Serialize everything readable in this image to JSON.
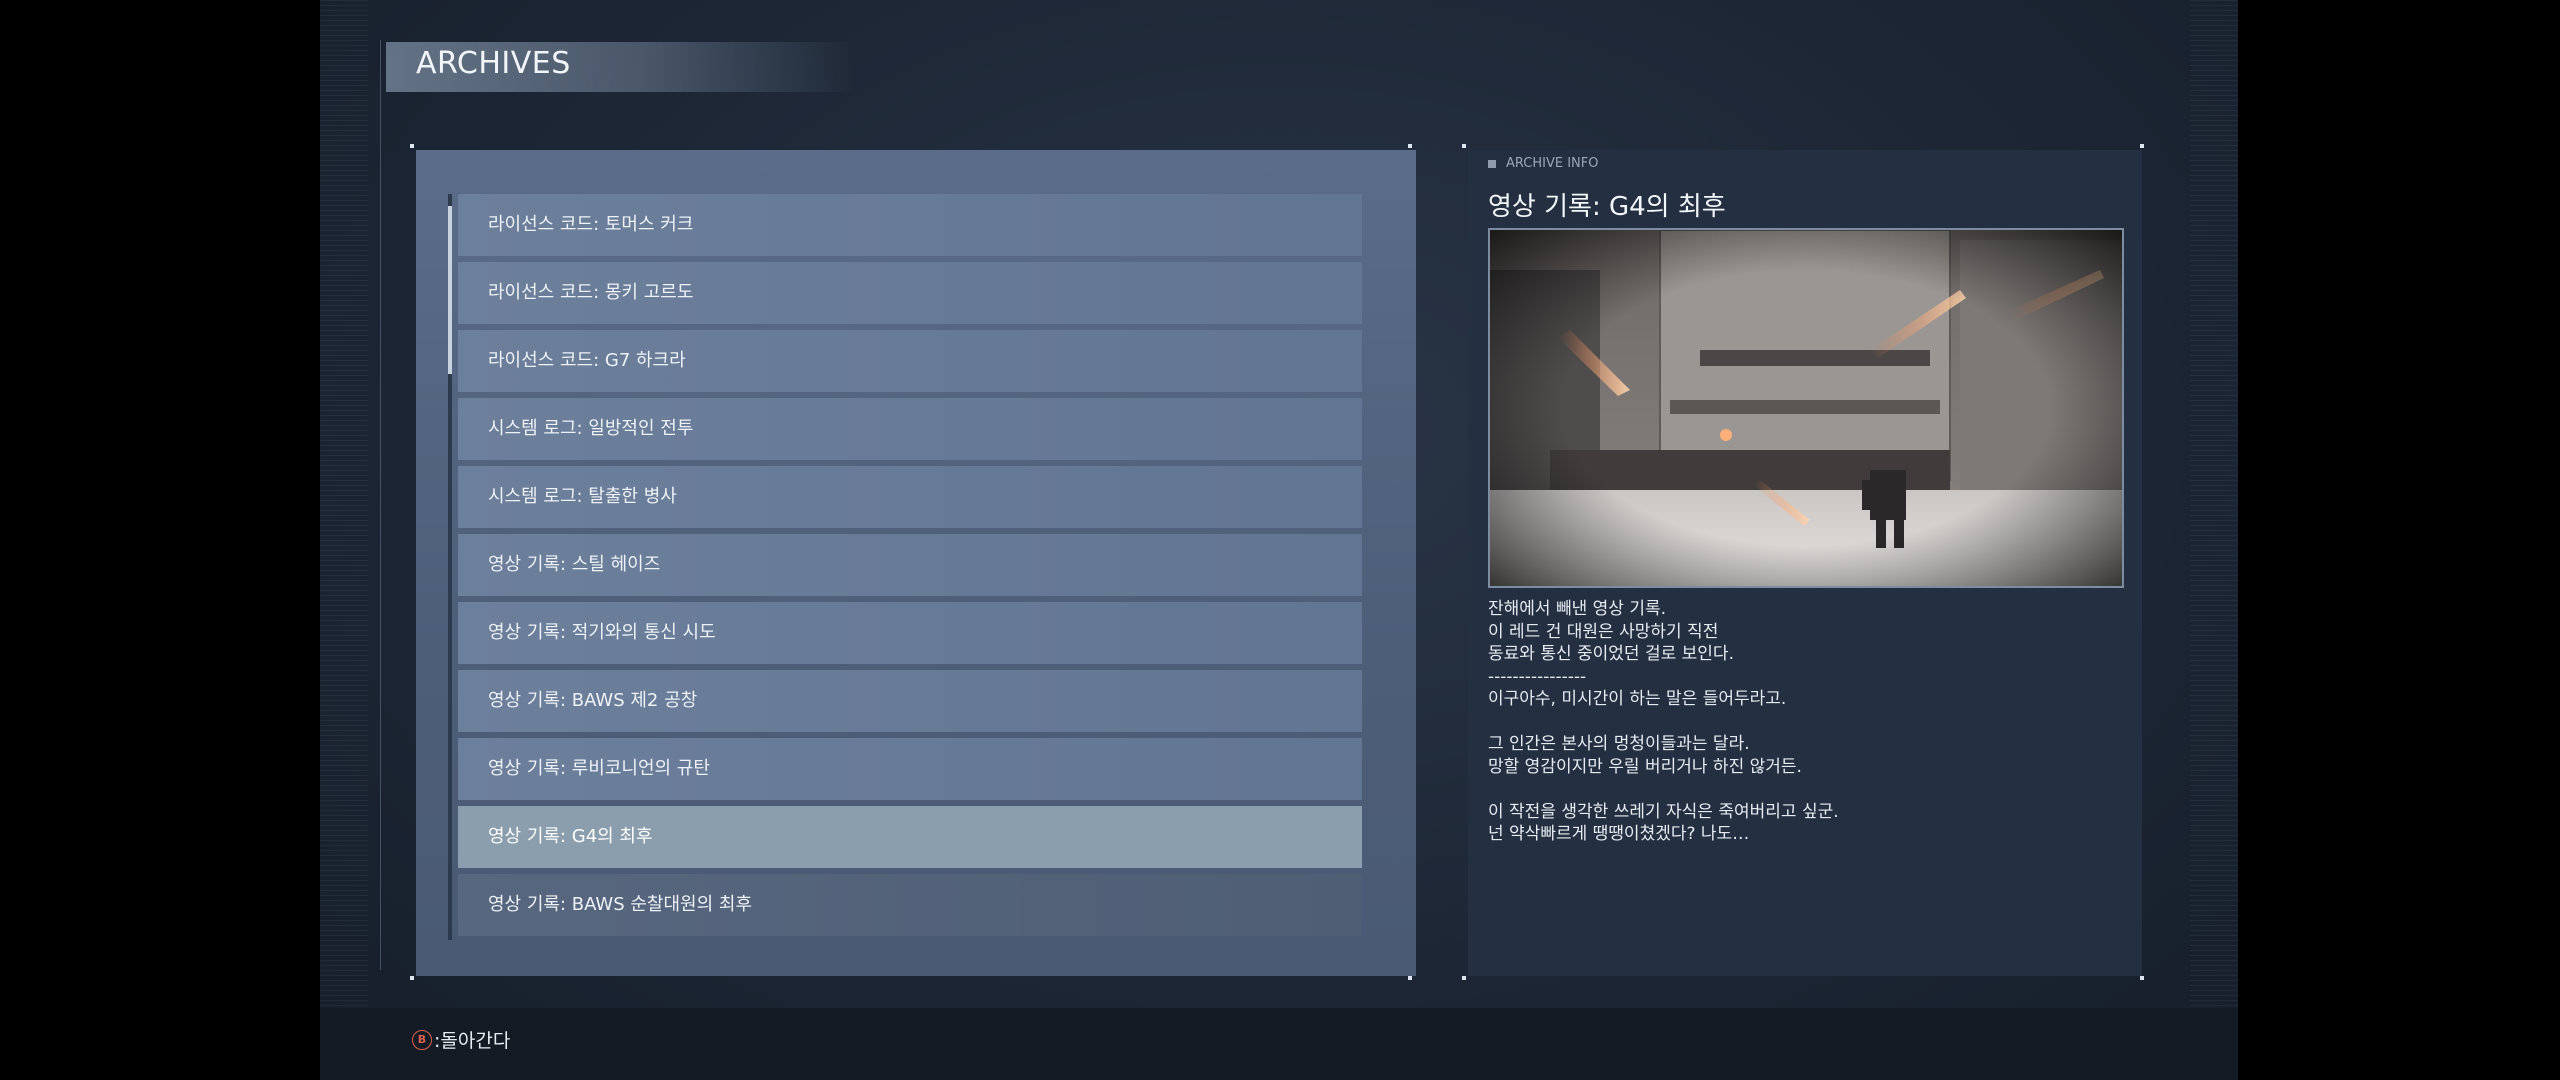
{
  "header": {
    "title": "ARCHIVES"
  },
  "archive_list": {
    "items": [
      {
        "label": "라이선스 코드: 토머스 커크"
      },
      {
        "label": "라이선스 코드: 몽키 고르도"
      },
      {
        "label": "라이선스 코드: G7 하크라"
      },
      {
        "label": "시스템 로그: 일방적인 전투"
      },
      {
        "label": "시스템 로그: 탈출한 병사"
      },
      {
        "label": "영상 기록: 스틸 헤이즈"
      },
      {
        "label": "영상 기록: 적기와의 통신 시도"
      },
      {
        "label": "영상 기록: BAWS 제2 공창"
      },
      {
        "label": "영상 기록: 루비코니언의 규탄"
      },
      {
        "label": "영상 기록: G4의 최후"
      },
      {
        "label": "영상 기록: BAWS 순찰대원의 최후"
      }
    ],
    "selected_index": 9
  },
  "info_panel": {
    "tag": "ARCHIVE INFO",
    "title": "영상 기록: G4의 최후",
    "description": [
      "잔해에서 빼낸 영상 기록.",
      "이 레드 건 대원은 사망하기 직전",
      "동료와 통신 중이었던 걸로 보인다.",
      "----------------",
      "이구아수, 미시간이 하는 말은 들어두라고.",
      "",
      "그 인간은 본사의 멍청이들과는 달라.",
      "망할 영감이지만 우릴 버리거나 하진 않거든.",
      "",
      "이 작전을 생각한 쓰레기 자식은 죽여버리고 싶군.",
      "넌 약삭빠르게 땡땡이쳤겠다? 나도…"
    ]
  },
  "footer": {
    "button_glyph": "B",
    "back_label": ":돌아간다"
  },
  "colors": {
    "panel_bg": "#4d5e79",
    "list_item": "#6c7f9b",
    "list_item_selected": "#8a9eae",
    "info_bg": "#243041",
    "button_b": "#d9614f"
  }
}
